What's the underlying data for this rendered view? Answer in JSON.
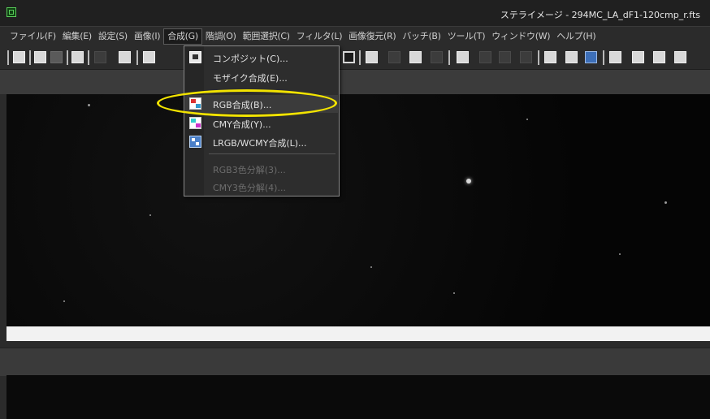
{
  "window": {
    "title": "ステライメージ - 294MC_LA_dF1-120cmp_r.fts"
  },
  "menubar": {
    "items": [
      {
        "label": "ファイル(F)"
      },
      {
        "label": "編集(E)"
      },
      {
        "label": "設定(S)"
      },
      {
        "label": "画像(I)"
      },
      {
        "label": "合成(G)",
        "active": true
      },
      {
        "label": "階調(O)"
      },
      {
        "label": "範囲選択(C)"
      },
      {
        "label": "フィルタ(L)"
      },
      {
        "label": "画像復元(R)"
      },
      {
        "label": "バッチ(B)"
      },
      {
        "label": "ツール(T)"
      },
      {
        "label": "ウィンドウ(W)"
      },
      {
        "label": "ヘルプ(H)"
      }
    ]
  },
  "composite_menu": {
    "items": [
      {
        "label": "コンポジット(C)...",
        "icon": "composite-icon",
        "enabled": true
      },
      {
        "label": "モザイク合成(E)...",
        "icon": "",
        "enabled": true
      },
      {
        "label": "RGB合成(B)...",
        "icon": "rgb-composite-icon",
        "enabled": true,
        "highlighted": true
      },
      {
        "label": "CMY合成(Y)...",
        "icon": "cmy-composite-icon",
        "enabled": true
      },
      {
        "label": "LRGB/WCMY合成(L)...",
        "icon": "lrgb-composite-icon",
        "enabled": true
      },
      {
        "label": "RGB3色分解(3)...",
        "icon": "",
        "enabled": false
      },
      {
        "label": "CMY3色分解(4)...",
        "icon": "",
        "enabled": false
      }
    ]
  },
  "annotation": {
    "color": "#f2e300",
    "target": "RGB合成(B)..."
  },
  "colors": {
    "background": "#2b2b2b",
    "menu_bg": "#2d2d2d",
    "menu_border": "#8a8a8a",
    "accent_highlight": "#f2e300"
  }
}
